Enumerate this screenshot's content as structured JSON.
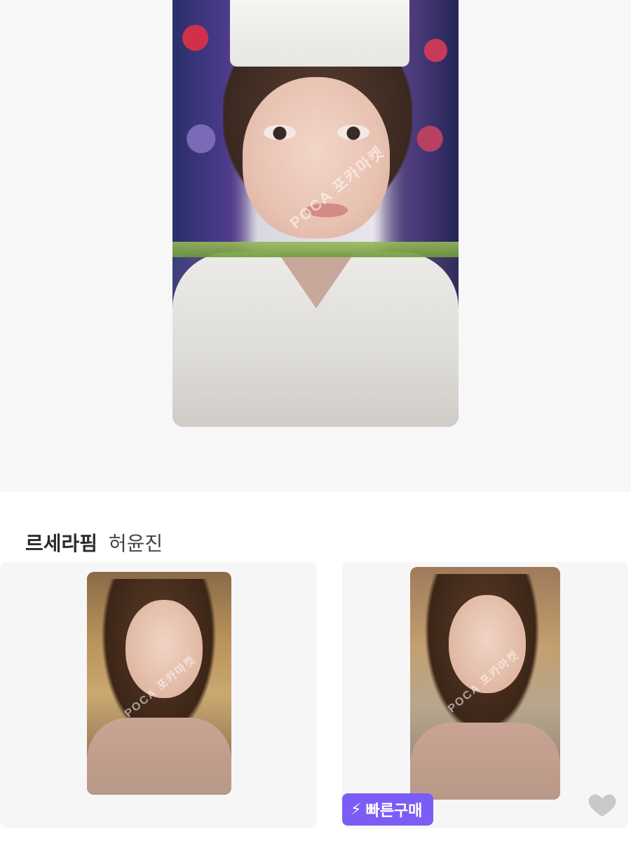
{
  "hero": {
    "image_alt": "photocard image",
    "watermark": "POCA 포카마켓"
  },
  "section": {
    "group_name": "르세라핌",
    "member_name": "허윤진"
  },
  "items": [
    {
      "image_alt": "photocard",
      "watermark": "POCA 포카마켓"
    },
    {
      "image_alt": "photocard",
      "watermark": "POCA 포카마켓",
      "badge_label": "빠른구매",
      "badge_icon": "lightning-icon",
      "like_icon": "heart-icon"
    }
  ],
  "colors": {
    "background": "#f7f7f8",
    "badge": "#7b5cf5",
    "heart": "#c9c9c9"
  }
}
